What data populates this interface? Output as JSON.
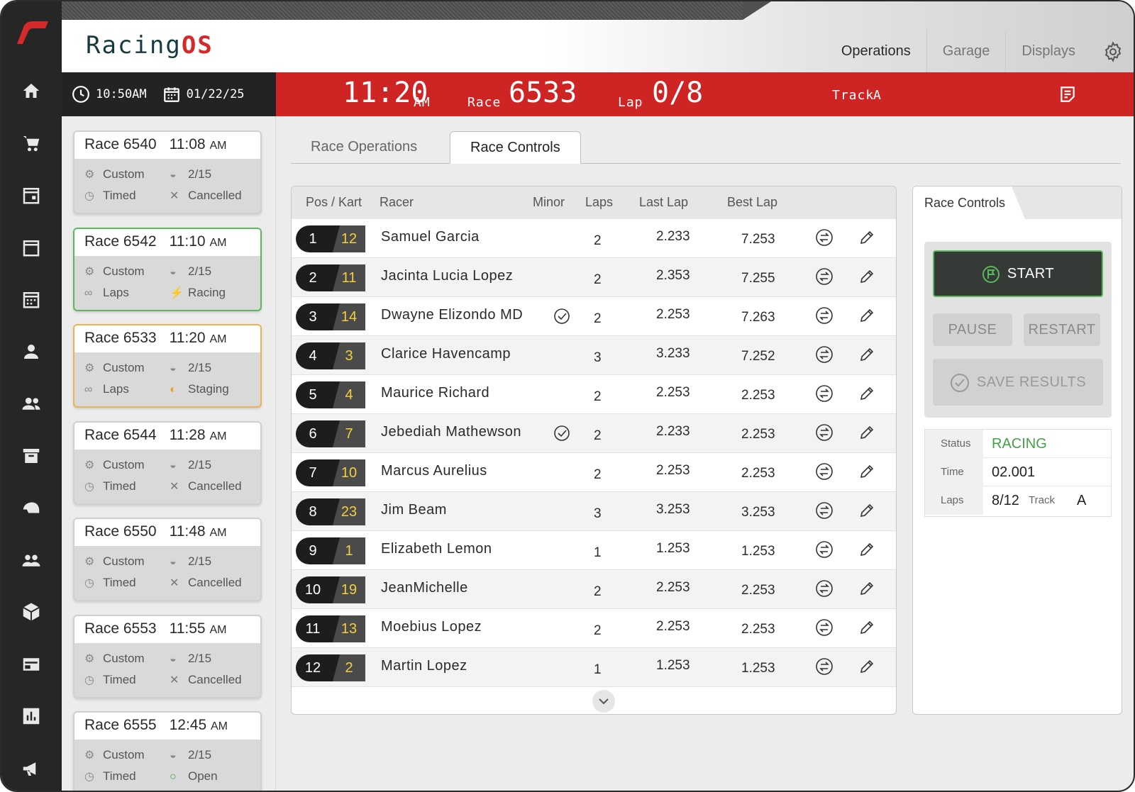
{
  "brand": {
    "name_a": "Racing",
    "name_b": "OS"
  },
  "topnav": [
    {
      "label": "Operations",
      "active": true
    },
    {
      "label": "Garage",
      "active": false
    },
    {
      "label": "Displays",
      "active": false
    }
  ],
  "sidebar_icons": [
    "home-icon",
    "cart-icon",
    "calendar-day-icon",
    "calendar-icon",
    "calendar-grid-icon",
    "person-icon",
    "group-icon",
    "archive-icon",
    "helmet-icon",
    "people-icon",
    "cube-icon",
    "display-icon",
    "chart-icon",
    "megaphone-icon"
  ],
  "clock": {
    "time": "10:50AM",
    "date": "01/22/25"
  },
  "current": {
    "time": "11:20",
    "ampm": "AM",
    "race_label": "Race",
    "race": "6533",
    "lap_label": "Lap",
    "lap": "0/8",
    "track_label": "Track",
    "track": "A"
  },
  "races": [
    {
      "label": "Race",
      "num": "6540",
      "time": "11:08",
      "ampm": "AM",
      "type": "Custom",
      "mode": "Timed",
      "count": "2/15",
      "status": "Cancelled",
      "state": "cancelled"
    },
    {
      "label": "Race",
      "num": "6542",
      "time": "11:10",
      "ampm": "AM",
      "type": "Custom",
      "mode": "Laps",
      "count": "2/15",
      "status": "Racing",
      "state": "racing"
    },
    {
      "label": "Race",
      "num": "6533",
      "time": "11:20",
      "ampm": "AM",
      "type": "Custom",
      "mode": "Laps",
      "count": "2/15",
      "status": "Staging",
      "state": "staging"
    },
    {
      "label": "Race",
      "num": "6544",
      "time": "11:28",
      "ampm": "AM",
      "type": "Custom",
      "mode": "Timed",
      "count": "2/15",
      "status": "Cancelled",
      "state": "cancelled"
    },
    {
      "label": "Race",
      "num": "6550",
      "time": "11:48",
      "ampm": "AM",
      "type": "Custom",
      "mode": "Timed",
      "count": "2/15",
      "status": "Cancelled",
      "state": "cancelled"
    },
    {
      "label": "Race",
      "num": "6553",
      "time": "11:55",
      "ampm": "AM",
      "type": "Custom",
      "mode": "Timed",
      "count": "2/15",
      "status": "Cancelled",
      "state": "cancelled"
    },
    {
      "label": "Race",
      "num": "6555",
      "time": "12:45",
      "ampm": "AM",
      "type": "Custom",
      "mode": "Timed",
      "count": "2/15",
      "status": "Open",
      "state": "open"
    }
  ],
  "tabs": [
    {
      "label": "Race Operations",
      "active": false
    },
    {
      "label": "Race Controls",
      "active": true
    }
  ],
  "table": {
    "headers": {
      "pos": "Pos / Kart",
      "racer": "Racer",
      "minor": "Minor",
      "laps": "Laps",
      "last": "Last Lap",
      "best": "Best Lap"
    },
    "rows": [
      {
        "pos": "1",
        "kart": "12",
        "name": "Samuel Garcia",
        "minor": false,
        "laps": "2",
        "last": "2.233",
        "best": "7.253"
      },
      {
        "pos": "2",
        "kart": "11",
        "name": "Jacinta Lucia Lopez",
        "minor": false,
        "laps": "2",
        "last": "2.353",
        "best": "7.255"
      },
      {
        "pos": "3",
        "kart": "14",
        "name": "Dwayne Elizondo MD",
        "minor": true,
        "laps": "2",
        "last": "2.253",
        "best": "7.263"
      },
      {
        "pos": "4",
        "kart": "3",
        "name": "Clarice Havencamp",
        "minor": false,
        "laps": "3",
        "last": "3.233",
        "best": "7.252"
      },
      {
        "pos": "5",
        "kart": "4",
        "name": "Maurice Richard",
        "minor": false,
        "laps": "2",
        "last": "2.253",
        "best": "2.253"
      },
      {
        "pos": "6",
        "kart": "7",
        "name": "Jebediah Mathewson",
        "minor": true,
        "laps": "2",
        "last": "2.233",
        "best": "2.253"
      },
      {
        "pos": "7",
        "kart": "10",
        "name": "Marcus Aurelius",
        "minor": false,
        "laps": "2",
        "last": "2.253",
        "best": "2.253"
      },
      {
        "pos": "8",
        "kart": "23",
        "name": "Jim Beam",
        "minor": false,
        "laps": "3",
        "last": "3.253",
        "best": "3.253"
      },
      {
        "pos": "9",
        "kart": "1",
        "name": "Elizabeth Lemon",
        "minor": false,
        "laps": "1",
        "last": "1.253",
        "best": "1.253"
      },
      {
        "pos": "10",
        "kart": "19",
        "name": "JeanMichelle",
        "minor": false,
        "laps": "2",
        "last": "2.253",
        "best": "2.253"
      },
      {
        "pos": "11",
        "kart": "13",
        "name": "Moebius Lopez",
        "minor": false,
        "laps": "2",
        "last": "2.253",
        "best": "2.253"
      },
      {
        "pos": "12",
        "kart": "2",
        "name": "Martin Lopez",
        "minor": false,
        "laps": "1",
        "last": "1.253",
        "best": "1.253"
      }
    ]
  },
  "controls": {
    "title": "Race Controls",
    "start": "START",
    "pause": "PAUSE",
    "restart": "RESTART",
    "save": "SAVE RESULTS",
    "status_label": "Status",
    "status": "RACING",
    "time_label": "Time",
    "time": "02.001",
    "laps_label": "Laps",
    "laps": "8/12",
    "track_label": "Track",
    "track": "A"
  },
  "colors": {
    "accent_red": "#cf2424",
    "racing_green": "#5cb85c",
    "staging_orange": "#f0b24e",
    "kart_yellow": "#f1d03c"
  }
}
